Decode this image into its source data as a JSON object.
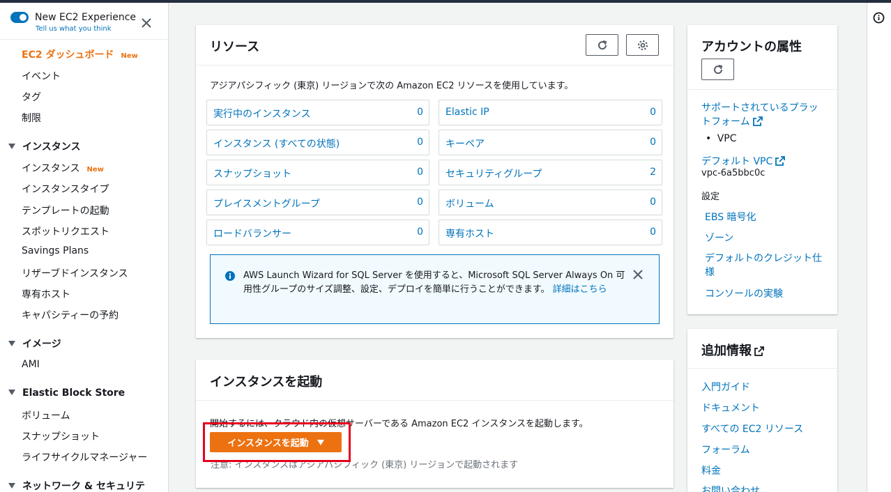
{
  "experience": {
    "title": "New EC2 Experience",
    "subtitle": "Tell us what you think"
  },
  "nav": {
    "dashboard": "EC2 ダッシュボード",
    "new_badge": "New",
    "top_items": [
      "イベント",
      "タグ",
      "制限"
    ],
    "instances_section": "インスタンス",
    "instances_items": [
      "インスタンス",
      "インスタンスタイプ",
      "テンプレートの起動",
      "スポットリクエスト",
      "Savings Plans",
      "リザーブドインスタンス",
      "専有ホスト",
      "キャパシティーの予約"
    ],
    "images_section": "イメージ",
    "images_items": [
      "AMI"
    ],
    "ebs_section": "Elastic Block Store",
    "ebs_items": [
      "ボリューム",
      "スナップショット",
      "ライフサイクルマネージャー"
    ],
    "network_section": "ネットワーク & セキュリテ"
  },
  "resources": {
    "title": "リソース",
    "description": "アジアパシフィック (東京) リージョンで次の Amazon EC2 リソースを使用しています。",
    "left": [
      {
        "label": "実行中のインスタンス",
        "value": "0"
      },
      {
        "label": "インスタンス (すべての状態)",
        "value": "0"
      },
      {
        "label": "スナップショット",
        "value": "0"
      },
      {
        "label": "プレイスメントグループ",
        "value": "0"
      },
      {
        "label": "ロードバランサー",
        "value": "0"
      }
    ],
    "right": [
      {
        "label": "Elastic IP",
        "value": "0"
      },
      {
        "label": "キーペア",
        "value": "0"
      },
      {
        "label": "セキュリティグループ",
        "value": "2"
      },
      {
        "label": "ボリューム",
        "value": "0"
      },
      {
        "label": "専有ホスト",
        "value": "0"
      }
    ],
    "alert_text": "AWS Launch Wizard for SQL Server を使用すると、Microsoft SQL Server Always On 可用性グループのサイズ調整、設定、デプロイを簡単に行うことができます。",
    "alert_link": "詳細はこちら"
  },
  "launch": {
    "title": "インスタンスを起動",
    "description": "開始するには、クラウド内の仮想サーバーである Amazon EC2 インスタンスを起動します。",
    "button": "インスタンスを起動",
    "note": "注意: インスタンスはアジアパシフィック (東京) リージョンで起動されます"
  },
  "account": {
    "title": "アカウントの属性",
    "supported_platforms": "サポートされているプラットフォーム",
    "platform_value": "VPC",
    "default_vpc": "デフォルト VPC",
    "default_vpc_value": "vpc-6a5bbc0c",
    "settings_label": "設定",
    "settings_links": [
      "EBS 暗号化",
      "ゾーン",
      "デフォルトのクレジット仕様",
      "コンソールの実験"
    ]
  },
  "additional": {
    "title": "追加情報",
    "links": [
      "入門ガイド",
      "ドキュメント",
      "すべての EC2 リソース",
      "フォーラム",
      "料金",
      "お問い合わせ"
    ]
  }
}
